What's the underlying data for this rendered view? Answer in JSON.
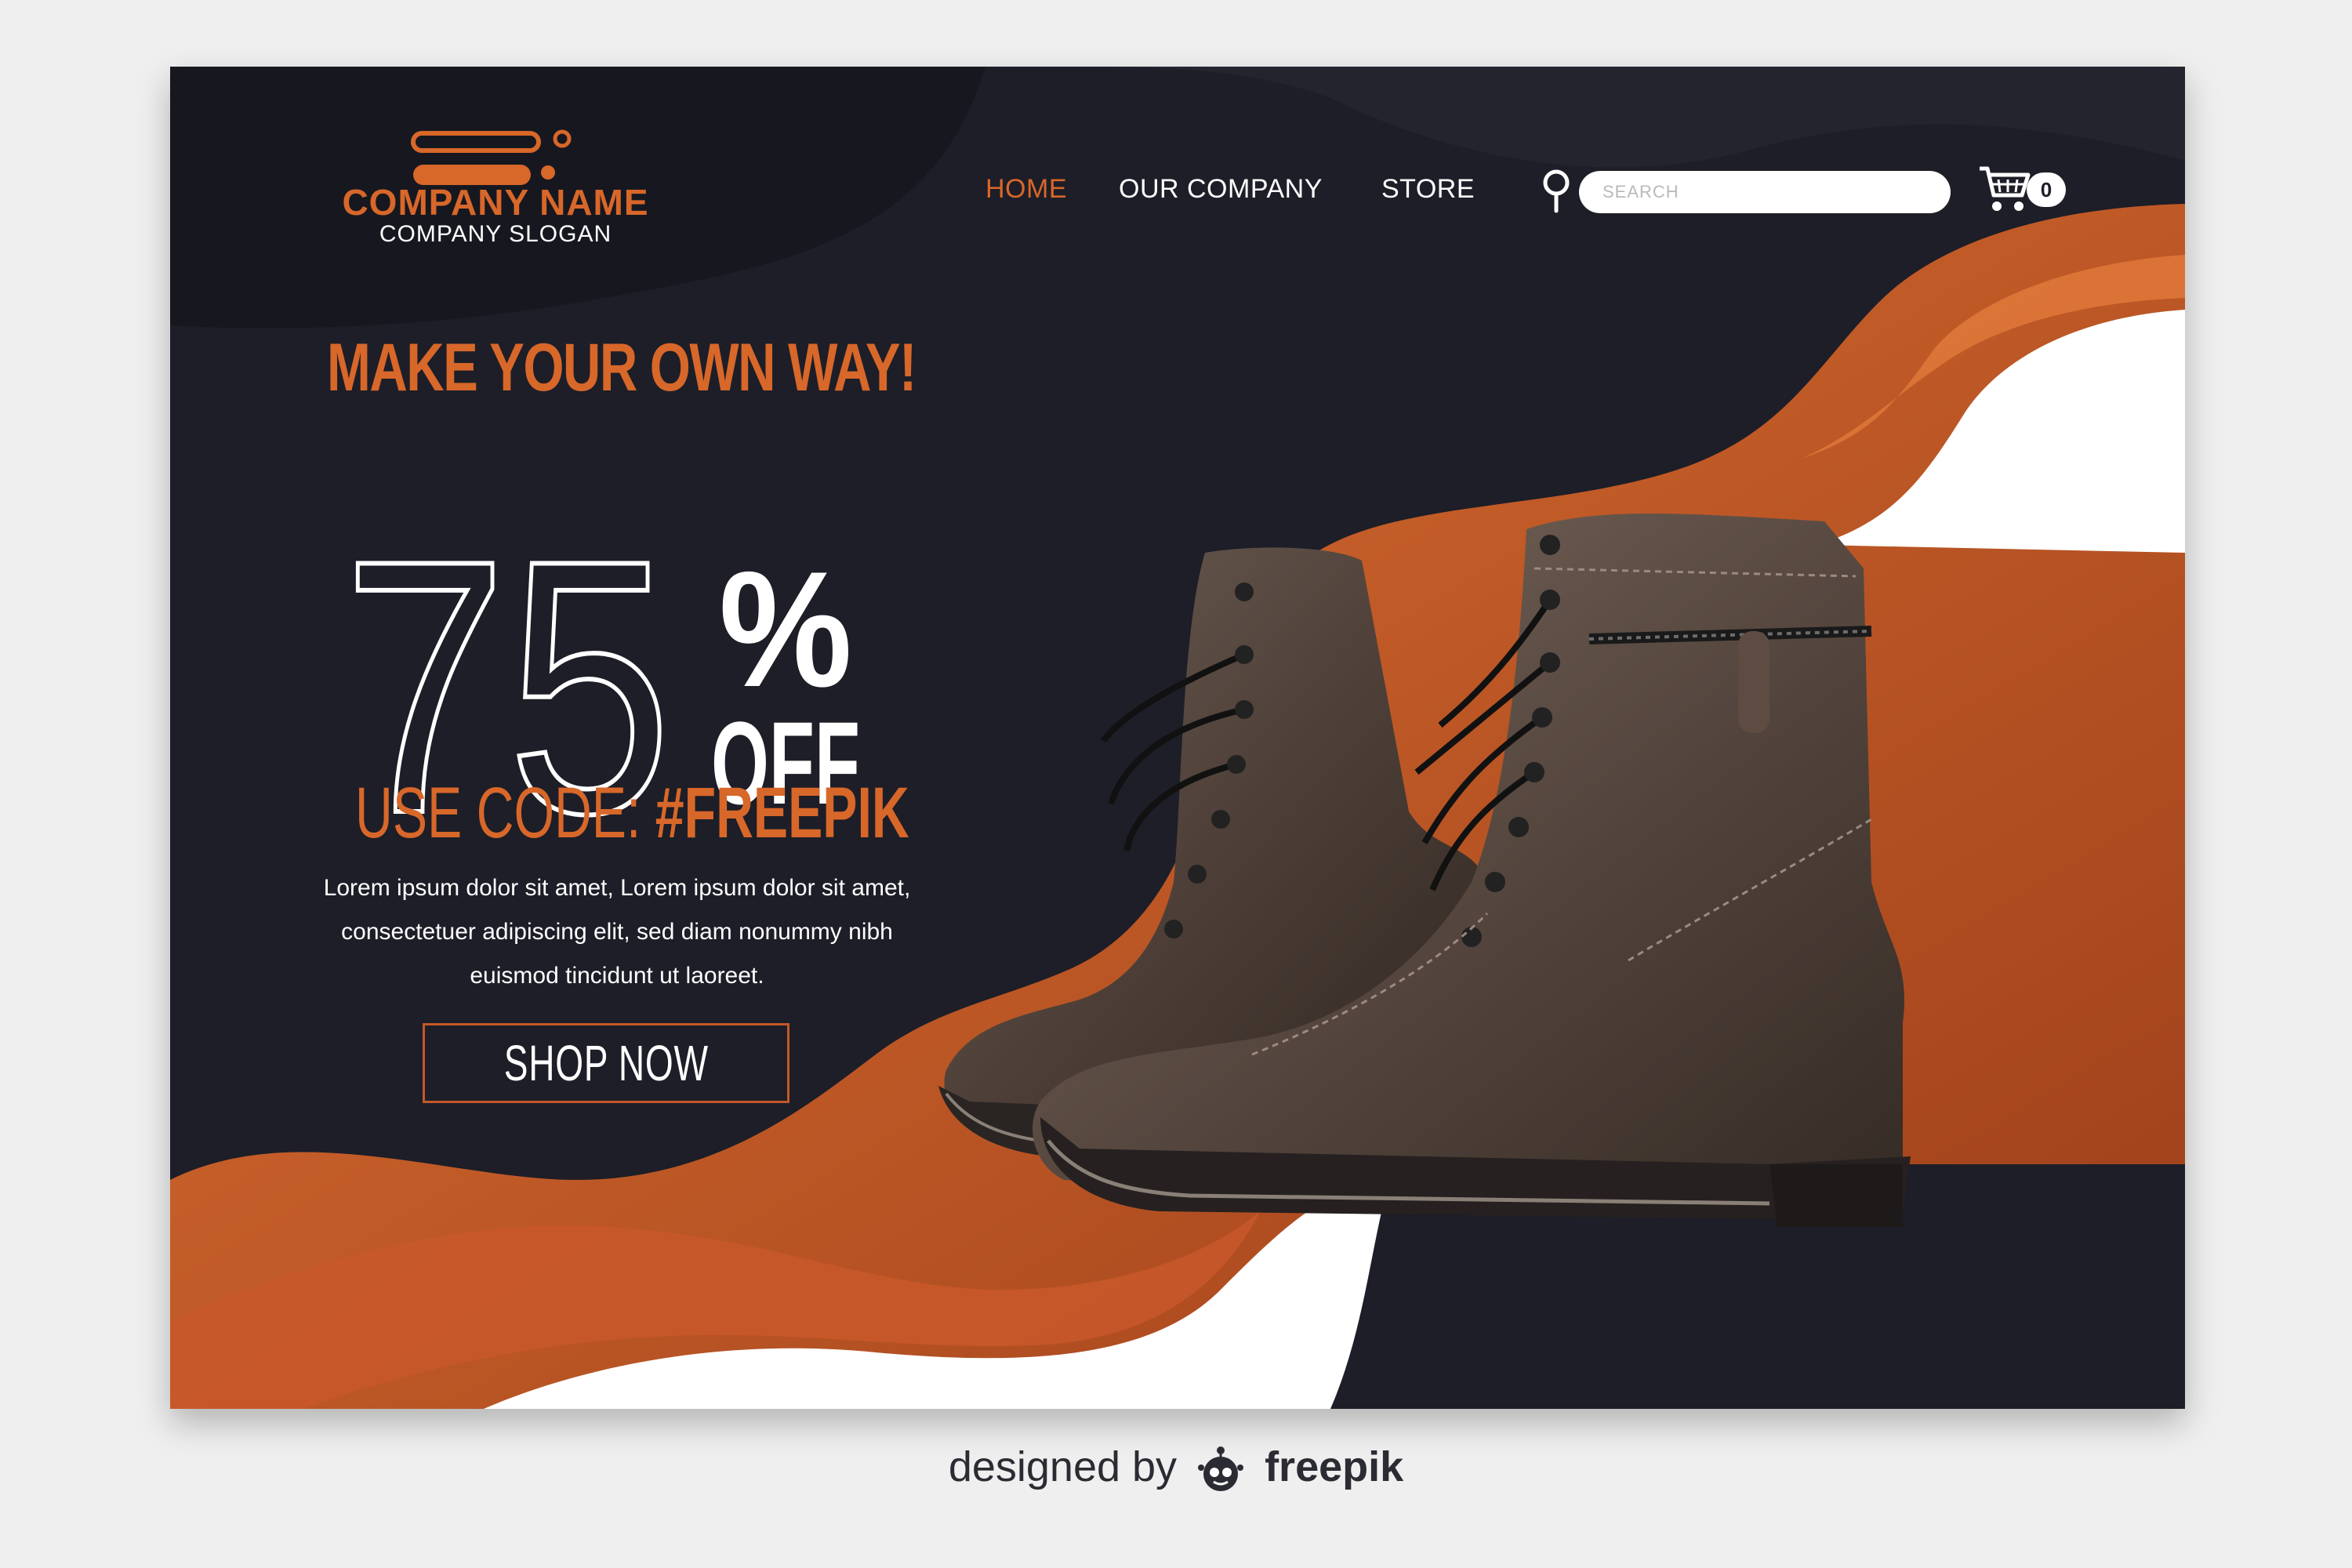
{
  "brand": {
    "name": "COMPANY NAME",
    "slogan": "COMPANY SLOGAN"
  },
  "nav": {
    "items": [
      "HOME",
      "OUR COMPANY",
      "STORE"
    ],
    "active": "HOME"
  },
  "search": {
    "placeholder": "SEARCH",
    "value": ""
  },
  "cart": {
    "count": "0"
  },
  "hero": {
    "headline": "MAKE YOUR OWN WAY!",
    "discount_number": "75",
    "percent_sign": "%",
    "off_label": "OFF",
    "code_prefix": "USE CODE: ",
    "code": "#FREEPIK",
    "body": "Lorem ipsum dolor sit amet, Lorem ipsum dolor sit amet, consectetuer adipiscing elit, sed diam nonummy nibh euismod tincidunt ut laoreet.",
    "cta_label": "SHOP NOW"
  },
  "footer": {
    "prefix": "designed by",
    "brand": "freepik"
  },
  "colors": {
    "background": "#1d1e27",
    "accent": "#d8672a",
    "accent_dark": "#a7411d",
    "page": "#efefef",
    "text": "#ffffff"
  },
  "icons": [
    "logo-icon",
    "search-icon",
    "cart-icon",
    "freepik-icon"
  ]
}
